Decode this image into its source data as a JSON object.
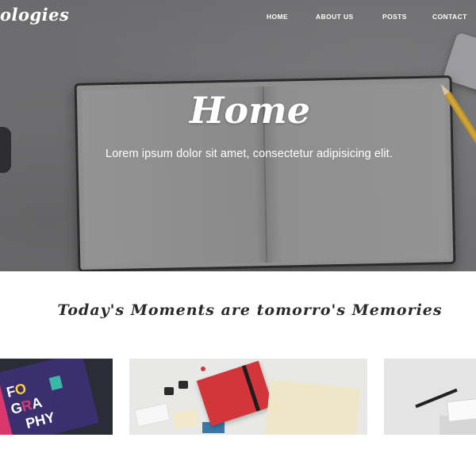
{
  "brand": {
    "name": "ologies"
  },
  "nav": {
    "items": [
      {
        "label": "HOME"
      },
      {
        "label": "ABOUT US"
      },
      {
        "label": "POSTS"
      },
      {
        "label": "CONTACT"
      }
    ]
  },
  "hero": {
    "title": "Home",
    "subtitle": "Lorem ipsum dolor sit amet, consectetur adipisicing elit."
  },
  "section": {
    "tagline": "Today's Moments are tomorro's Memories"
  },
  "gallery": {
    "cards": [
      {
        "letters": "FO GRA PHY"
      },
      {
        "letters": ""
      },
      {
        "letters": ""
      }
    ]
  },
  "colors": {
    "hero_overlay": "#6f6f71",
    "text_light": "#ffffff",
    "tagline_text": "#2a2a2a",
    "accent_red": "#d3363a"
  }
}
